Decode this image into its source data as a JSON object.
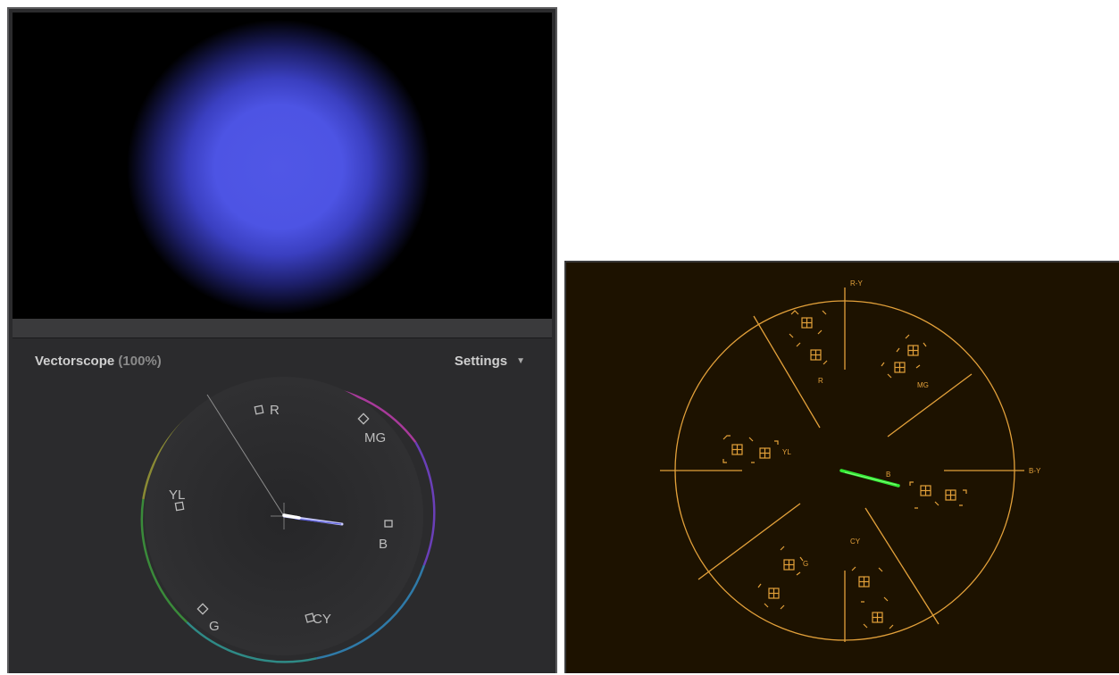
{
  "left_panel": {
    "scope_title": "Vectorscope",
    "scope_zoom": "(100%)",
    "settings_label": "Settings",
    "targets": {
      "r": "R",
      "mg": "MG",
      "b": "B",
      "cy": "CY",
      "g": "G",
      "yl": "YL"
    },
    "preview_color": "#4d54e4",
    "trace_color": "#d7d7ff"
  },
  "right_panel": {
    "axis_labels": {
      "r_y": "R-Y",
      "b_y": "B-Y"
    },
    "targets": {
      "r": "R",
      "mg": "MG",
      "b": "B",
      "cy": "CY",
      "g": "G",
      "yl": "YL"
    },
    "graticule_color": "#e3a13a",
    "trace_color": "#33e833"
  }
}
